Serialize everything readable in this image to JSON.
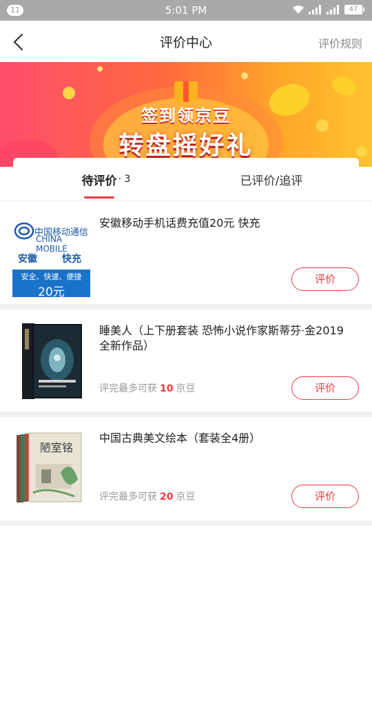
{
  "status_bar": {
    "notification_count": "11",
    "time": "5:01 PM",
    "battery": "47"
  },
  "header": {
    "title": "评价中心",
    "rules_link": "评价规则",
    "back_icon": "chevron-left-icon"
  },
  "banner": {
    "line1": "签到领京豆",
    "line2": "转盘摇好礼"
  },
  "tabs": [
    {
      "label": "待评价",
      "count": "· 3",
      "active": true
    },
    {
      "label": "已评价/追评",
      "active": false
    }
  ],
  "products": [
    {
      "title": "安徽移动手机话费充值20元 快充",
      "reward_prefix": "",
      "reward_points": "",
      "reward_suffix": "",
      "button": "评价",
      "thumb": {
        "brand_cn": "中国移动通信",
        "brand_en": "CHINA MOBILE",
        "region": "安徽",
        "fast": "快充",
        "slogan": "安全、快速、便捷",
        "amount": "20元"
      }
    },
    {
      "title": "睡美人（上下册套装 恐怖小说作家斯蒂芬·金2019全新作品）",
      "reward_prefix": "评完最多可获",
      "reward_points": "10",
      "reward_suffix": "京豆",
      "button": "评价"
    },
    {
      "title": "中国古典美文绘本（套装全4册）",
      "reward_prefix": "评完最多可获",
      "reward_points": "20",
      "reward_suffix": "京豆",
      "button": "评价"
    }
  ],
  "colors": {
    "accent": "#e93b3d",
    "status_bar": "#a9a9a9",
    "cmcc_blue": "#1b5aa8"
  }
}
